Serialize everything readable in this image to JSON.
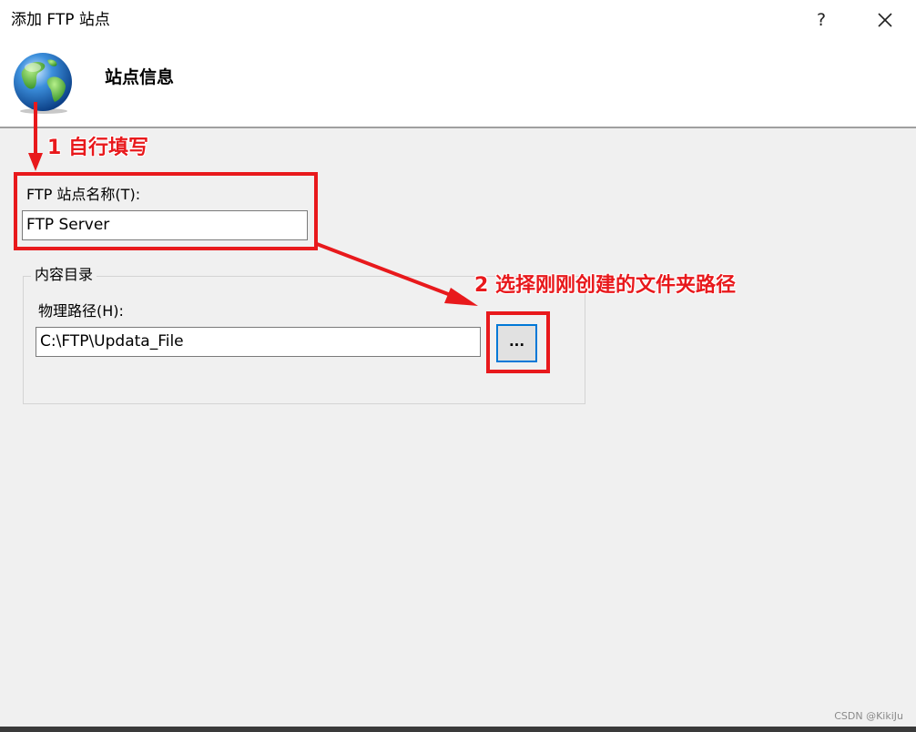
{
  "window": {
    "title": "添加 FTP 站点",
    "help_label": "?",
    "close_icon": "close-icon"
  },
  "header": {
    "title": "站点信息",
    "icon": "globe-icon"
  },
  "site_name": {
    "label": "FTP 站点名称(T):",
    "value": "FTP Server"
  },
  "content_dir": {
    "legend": "内容目录",
    "path_label": "物理路径(H):",
    "path_value": "C:\\FTP\\Updata_File",
    "browse_label": "..."
  },
  "annotations": {
    "step1": "1 自行填写",
    "step2": "2 选择刚刚创建的文件夹路径",
    "color": "#e8191c"
  },
  "watermark": "CSDN @KikiJu",
  "colors": {
    "focus_border": "#0078d7",
    "dialog_bg": "#f0f0f0"
  }
}
